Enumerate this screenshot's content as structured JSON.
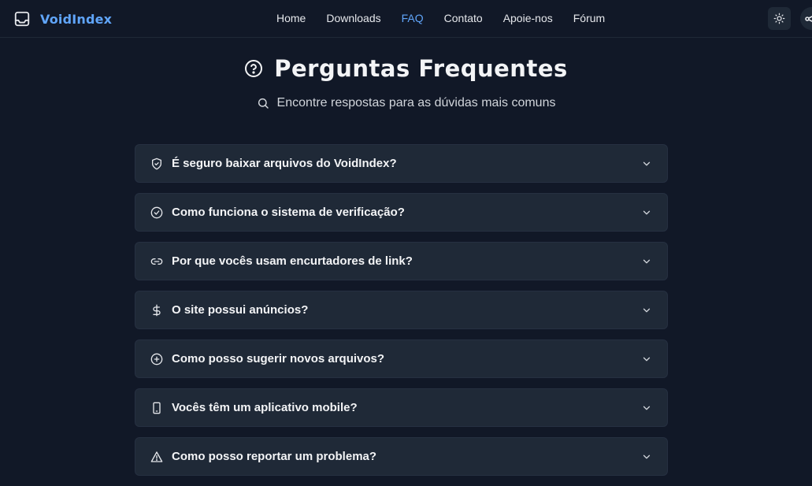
{
  "brand": {
    "name": "VoidIndex",
    "accent": "#60a5fa"
  },
  "nav": {
    "links": [
      {
        "label": "Home",
        "active": false
      },
      {
        "label": "Downloads",
        "active": false
      },
      {
        "label": "FAQ",
        "active": true
      },
      {
        "label": "Contato",
        "active": false
      },
      {
        "label": "Apoie-nos",
        "active": false
      },
      {
        "label": "Fórum",
        "active": false
      }
    ],
    "theme_toggle_icon": "sun-icon"
  },
  "hero": {
    "title": "Perguntas Frequentes",
    "title_icon": "help-circle-icon",
    "subtitle": "Encontre respostas para as dúvidas mais comuns",
    "subtitle_icon": "search-icon"
  },
  "faq": [
    {
      "question": "É seguro baixar arquivos do VoidIndex?",
      "icon": "shield-icon"
    },
    {
      "question": "Como funciona o sistema de verificação?",
      "icon": "check-circle-icon"
    },
    {
      "question": "Por que vocês usam encurtadores de link?",
      "icon": "link-icon"
    },
    {
      "question": "O site possui anúncios?",
      "icon": "dollar-icon"
    },
    {
      "question": "Como posso sugerir novos arquivos?",
      "icon": "plus-circle-icon"
    },
    {
      "question": "Vocês têm um aplicativo mobile?",
      "icon": "smartphone-icon"
    },
    {
      "question": "Como posso reportar um problema?",
      "icon": "alert-triangle-icon"
    }
  ]
}
